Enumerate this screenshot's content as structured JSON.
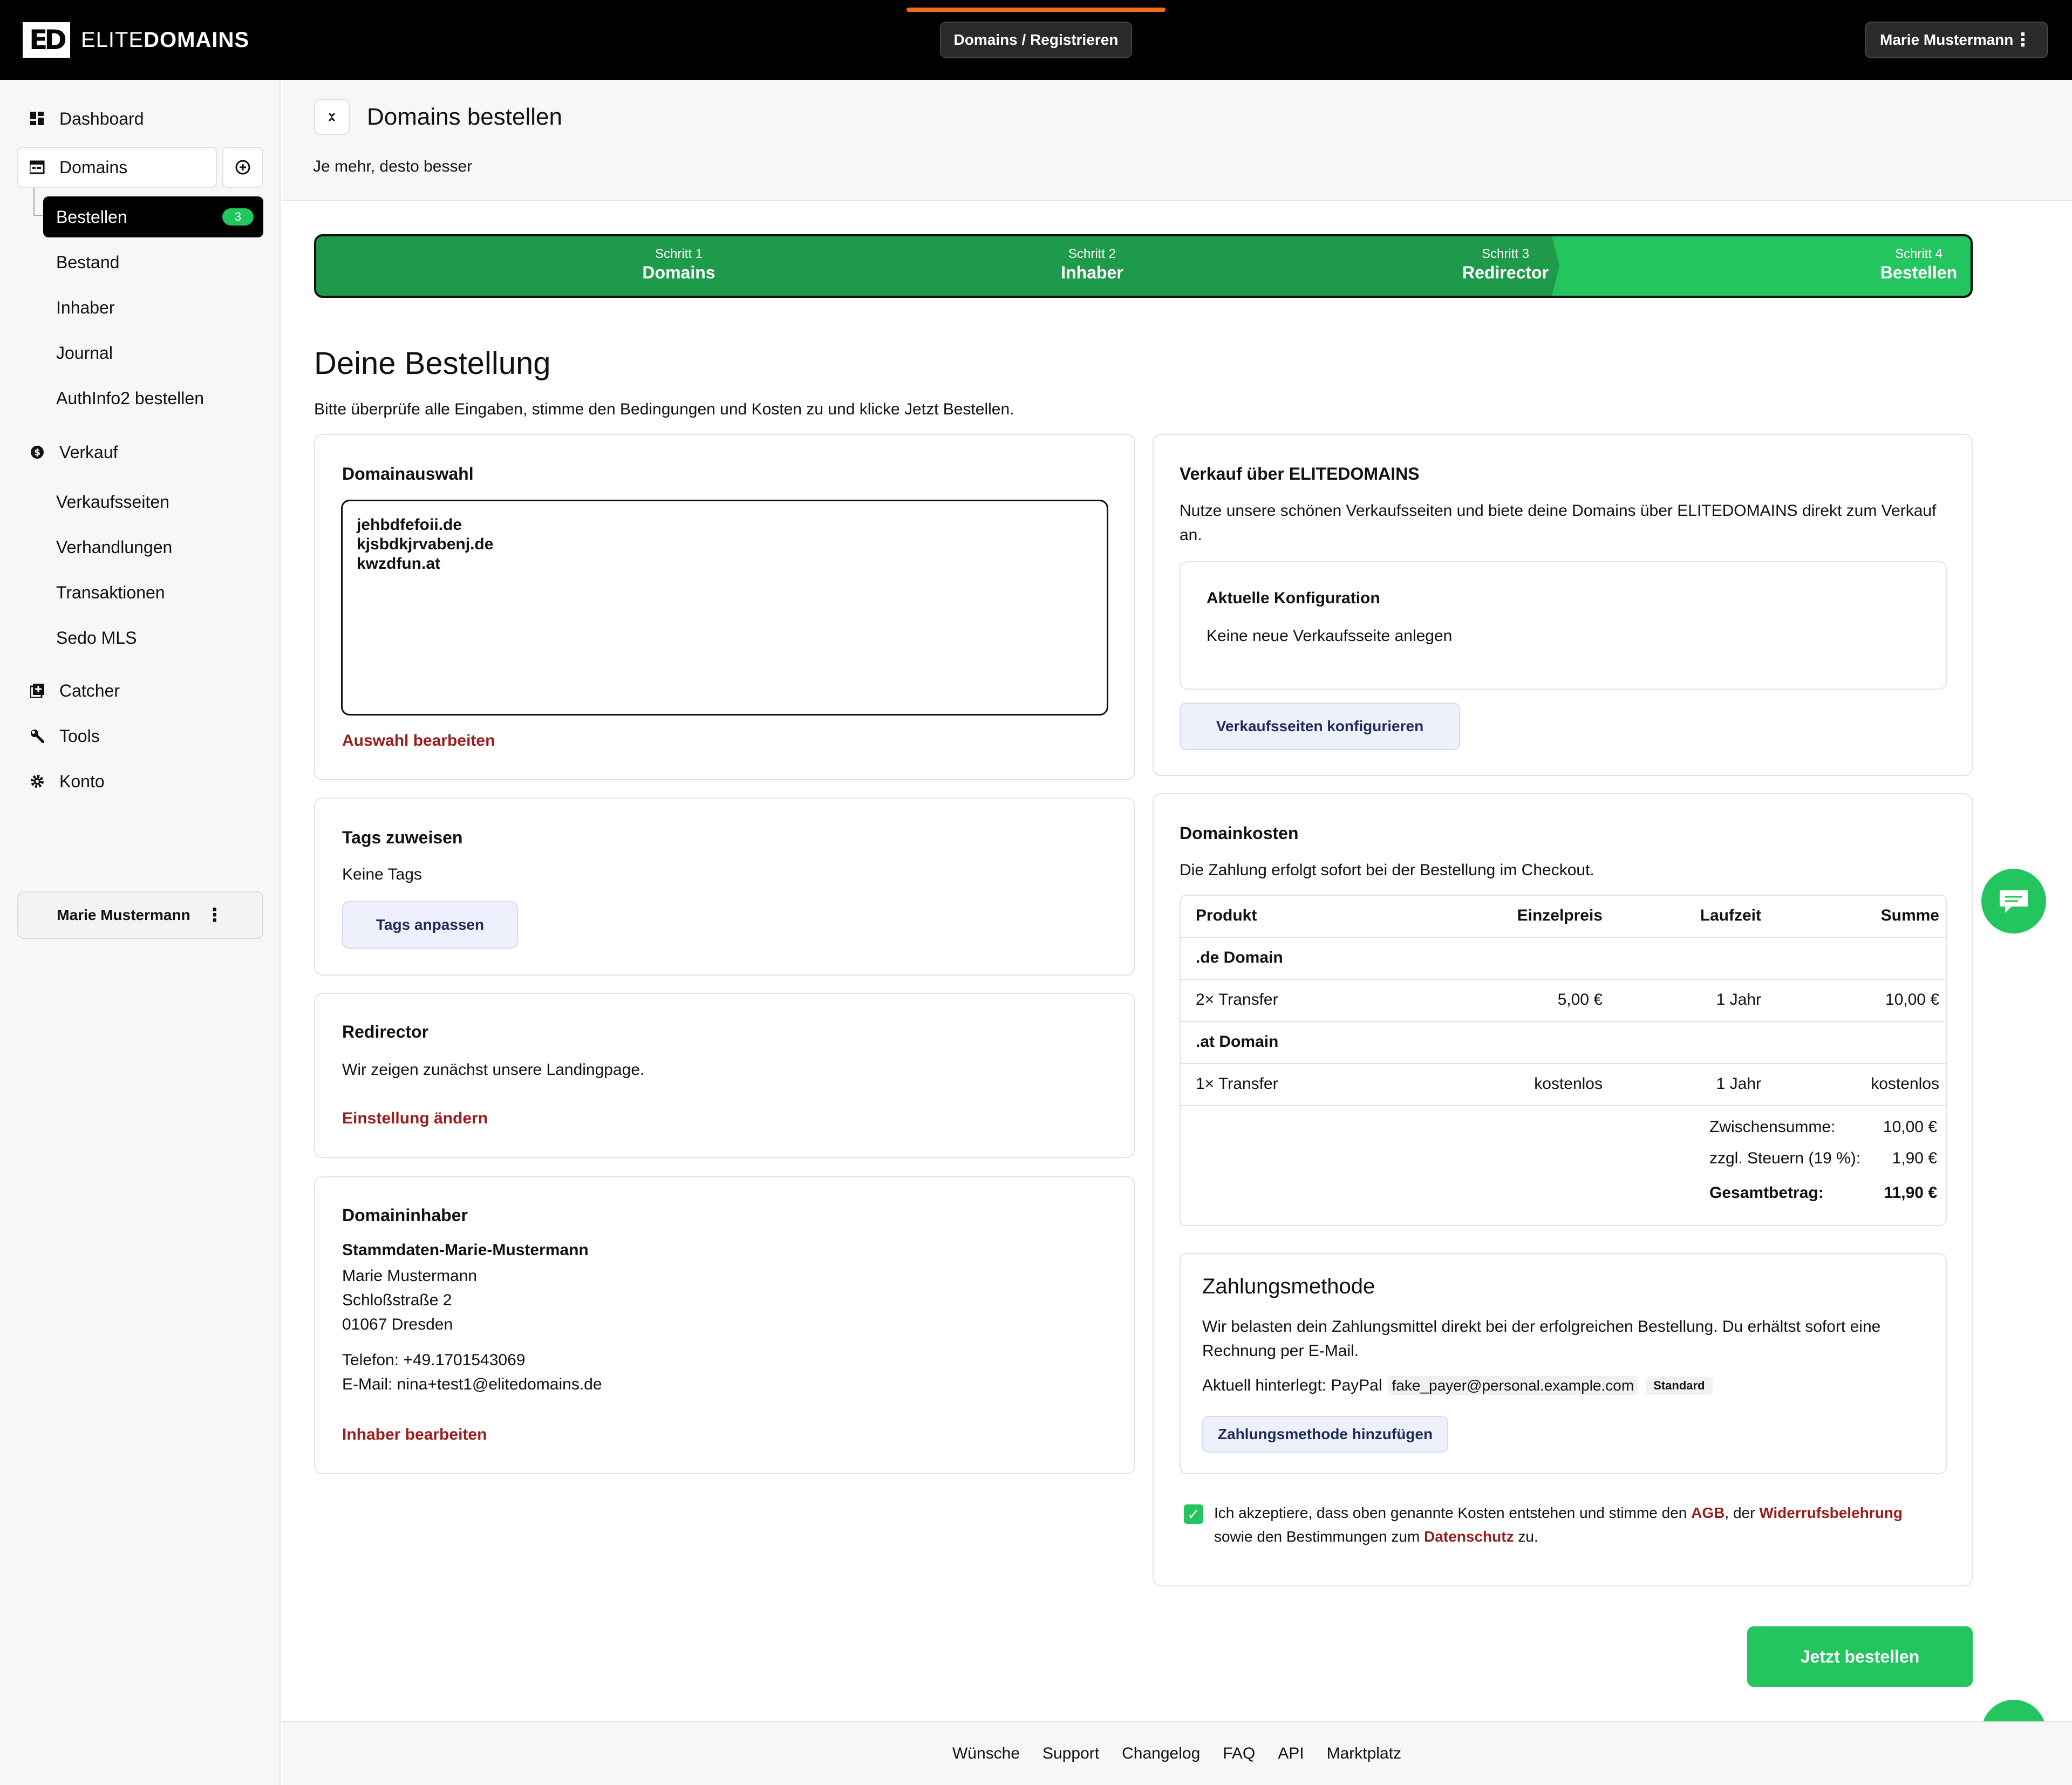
{
  "header": {
    "logo_mark": "ED",
    "logo_text_1": "ELITE",
    "logo_text_2": "DOMAINS",
    "breadcrumb": "Domains / Registrieren",
    "user_name": "Marie Mustermann"
  },
  "sidebar": {
    "dashboard": "Dashboard",
    "domains": "Domains",
    "bestellen": "Bestellen",
    "bestellen_badge": "3",
    "bestand": "Bestand",
    "inhaber": "Inhaber",
    "journal": "Journal",
    "authinfo": "AuthInfo2 bestellen",
    "verkauf": "Verkauf",
    "verkaufsseiten": "Verkaufsseiten",
    "verhandlungen": "Verhandlungen",
    "transaktionen": "Transaktionen",
    "sedo": "Sedo MLS",
    "catcher": "Catcher",
    "tools": "Tools",
    "konto": "Konto",
    "user_name": "Marie Mustermann"
  },
  "page": {
    "title": "Domains bestellen",
    "subtitle": "Je mehr, desto besser"
  },
  "steps": [
    {
      "label": "Schritt 1",
      "name": "Domains"
    },
    {
      "label": "Schritt 2",
      "name": "Inhaber"
    },
    {
      "label": "Schritt 3",
      "name": "Redirector"
    },
    {
      "label": "Schritt 4",
      "name": "Bestellen"
    }
  ],
  "order": {
    "heading": "Deine Bestellung",
    "intro": "Bitte überprüfe alle Eingaben, stimme den Bedingungen und Kosten zu und klicke Jetzt Bestellen."
  },
  "domain_selection": {
    "title": "Domainauswahl",
    "domains": "jehbdfefoii.de\nkjsbdkjrvabenj.de\nkwzdfun.at",
    "edit_link": "Auswahl bearbeiten"
  },
  "tags": {
    "title": "Tags zuweisen",
    "value": "Keine Tags",
    "button": "Tags anpassen"
  },
  "redirector": {
    "title": "Redirector",
    "text": "Wir zeigen zunächst unsere Landingpage.",
    "link": "Einstellung ändern"
  },
  "owner": {
    "title": "Domaininhaber",
    "profile": "Stammdaten-Marie-Mustermann",
    "name": "Marie Mustermann",
    "street": "Schloßstraße 2",
    "city": "01067 Dresden",
    "phone": "Telefon: +49.1701543069",
    "email": "E-Mail: nina+test1@elitedomains.de",
    "link": "Inhaber bearbeiten"
  },
  "sale": {
    "title": "Verkauf über ELITEDOMAINS",
    "text": "Nutze unsere schönen Verkaufsseiten und biete deine Domains über ELITEDOMAINS direkt zum Verkauf an.",
    "config_title": "Aktuelle Konfiguration",
    "config_value": "Keine neue Verkaufsseite anlegen",
    "button": "Verkaufsseiten konfigurieren"
  },
  "costs": {
    "title": "Domainkosten",
    "text": "Die Zahlung erfolgt sofort bei der Bestellung im Checkout.",
    "headers": [
      "Produkt",
      "Einzelpreis",
      "Laufzeit",
      "Summe"
    ],
    "group_de": ".de Domain",
    "row_de": [
      "2× Transfer",
      "5,00 €",
      "1 Jahr",
      "10,00 €"
    ],
    "group_at": ".at Domain",
    "row_at": [
      "1× Transfer",
      "kostenlos",
      "1 Jahr",
      "kostenlos"
    ],
    "subtotal_label": "Zwischensumme:",
    "subtotal": "10,00 €",
    "tax_label": "zzgl. Steuern (19 %):",
    "tax": "1,90 €",
    "total_label": "Gesamtbetrag:",
    "total": "11,90 €"
  },
  "payment": {
    "title": "Zahlungsmethode",
    "text": "Wir belasten dein Zahlungsmittel direkt bei der erfolgreichen Bestellung. Du erhältst sofort eine Rechnung per E-Mail.",
    "current_prefix": "Aktuell hinterlegt: PayPal",
    "email": "fake_payer@personal.example.com",
    "standard": "Standard",
    "button": "Zahlungsmethode hinzufügen"
  },
  "terms": {
    "t1": "Ich akzeptiere, dass oben genannte Kosten entstehen und stimme den ",
    "agb": "AGB",
    "t2": ", der ",
    "widerruf": "Widerrufsbelehrung",
    "t3": "sowie den Bestimmungen zum ",
    "datenschutz": "Datenschutz",
    "t4": " zu."
  },
  "order_button": "Jetzt bestellen",
  "footer": [
    "Wünsche",
    "Support",
    "Changelog",
    "FAQ",
    "API",
    "Marktplatz"
  ],
  "colors": {
    "accent_green": "#22c55e",
    "step_done": "#1e9a4b",
    "link_red": "#9b1c1c",
    "progress_orange": "#f26b1d"
  }
}
